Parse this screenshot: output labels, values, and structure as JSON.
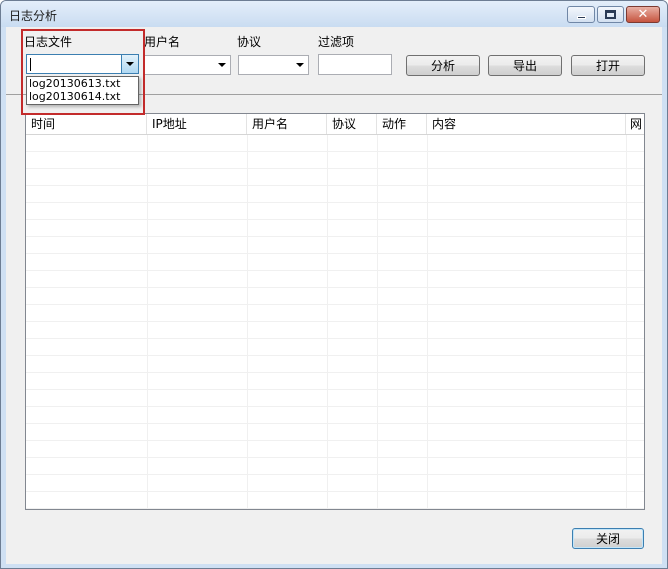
{
  "window": {
    "title": "日志分析",
    "controls": {
      "minimize": "minimize",
      "maximize": "maximize",
      "close": "✕"
    }
  },
  "filters": {
    "log_file": {
      "label": "日志文件",
      "value": "",
      "options": [
        "log20130613.txt",
        "log20130614.txt"
      ]
    },
    "username": {
      "label": "用户名",
      "value": ""
    },
    "protocol": {
      "label": "协议",
      "value": ""
    },
    "filter": {
      "label": "过滤项",
      "value": ""
    }
  },
  "buttons": {
    "analyze": "分析",
    "export": "导出",
    "open": "打开",
    "close": "关闭"
  },
  "table": {
    "columns": [
      "时间",
      "IP地址",
      "用户名",
      "协议",
      "动作",
      "内容",
      "网"
    ],
    "rows": []
  }
}
